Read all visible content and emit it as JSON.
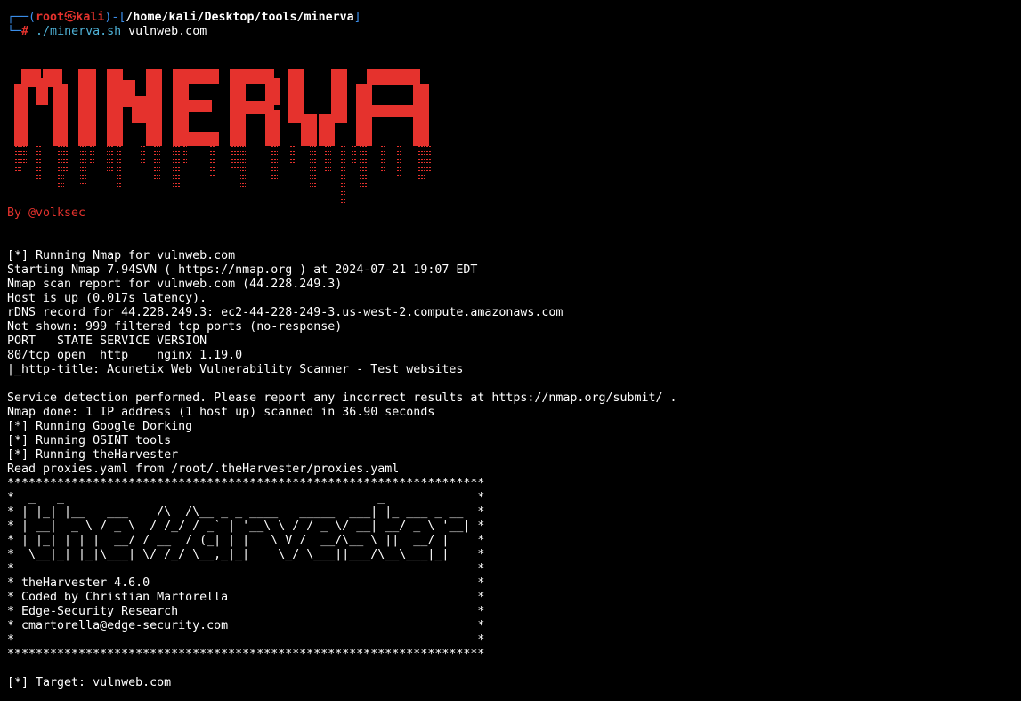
{
  "prompt": {
    "open_bracket": "┌──(",
    "user": "root",
    "at_symbol": "㉿",
    "host": "kali",
    "mid": ")-[",
    "path": "/home/kali/Desktop/tools/minerva",
    "close_bracket": "]",
    "second_line_prefix": "└─",
    "hash": "#",
    "command": "./minerva.sh",
    "argument": "vulnweb.com"
  },
  "banner": {
    "logo_text": "MINERVA",
    "logo_color": "#e5322d",
    "byline": "By @volksec"
  },
  "output_lines": [
    "[*] Running Nmap for vulnweb.com",
    "Starting Nmap 7.94SVN ( https://nmap.org ) at 2024-07-21 19:07 EDT",
    "Nmap scan report for vulnweb.com (44.228.249.3)",
    "Host is up (0.017s latency).",
    "rDNS record for 44.228.249.3: ec2-44-228-249-3.us-west-2.compute.amazonaws.com",
    "Not shown: 999 filtered tcp ports (no-response)",
    "PORT   STATE SERVICE VERSION",
    "80/tcp open  http    nginx 1.19.0",
    "|_http-title: Acunetix Web Vulnerability Scanner - Test websites",
    "",
    "Service detection performed. Please report any incorrect results at https://nmap.org/submit/ .",
    "Nmap done: 1 IP address (1 host up) scanned in 36.90 seconds",
    "[*] Running Google Dorking",
    "[*] Running OSINT tools",
    "[*] Running theHarvester",
    "Read proxies.yaml from /root/.theHarvester/proxies.yaml",
    "*******************************************************************",
    "*  _   _                                            _             *",
    "* | |_| |__   ___    /\\  /\\__ _ _ ____   _____  ___| |_ ___ _ __  *",
    "* | __|  _ \\ / _ \\  / /_/ / _` | '__\\ \\ / / _ \\/ __| __/ _ \\ '__| *",
    "* | |_| | | |  __/ / __  / (_| | |   \\ V /  __/\\__ \\ ||  __/ |    *",
    "*  \\__|_| |_|\\___| \\/ /_/ \\__,_|_|    \\_/ \\___||___/\\__\\___|_|    *",
    "*                                                                 *",
    "* theHarvester 4.6.0                                              *",
    "* Coded by Christian Martorella                                   *",
    "* Edge-Security Research                                          *",
    "* cmartorella@edge-security.com                                   *",
    "*                                                                 *",
    "*******************************************************************",
    "",
    "[*] Target: vulnweb.com"
  ]
}
